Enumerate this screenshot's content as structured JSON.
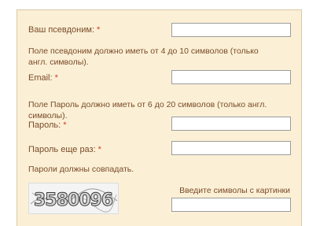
{
  "form": {
    "nickname": {
      "label": "Ваш псевдоним:",
      "required": "*",
      "hint": "Поле псевдоним должно иметь от 4 до 10 символов (только англ. символы)."
    },
    "email": {
      "label": "Email:",
      "required": "*"
    },
    "password_hint": "Поле Пароль должно иметь от 6 до 20 символов (только англ. символы).",
    "password": {
      "label": "Пароль:",
      "required": "*"
    },
    "password_repeat": {
      "label": "Пароль еще раз:",
      "required": "*",
      "hint": "Пароли должны совпадать."
    },
    "captcha": {
      "text": "3580096",
      "label": "Введите символы с картинки"
    }
  },
  "colors": {
    "panel_bg": "#fbf0d6",
    "text": "#7a4a28",
    "required": "#d23a2a"
  }
}
